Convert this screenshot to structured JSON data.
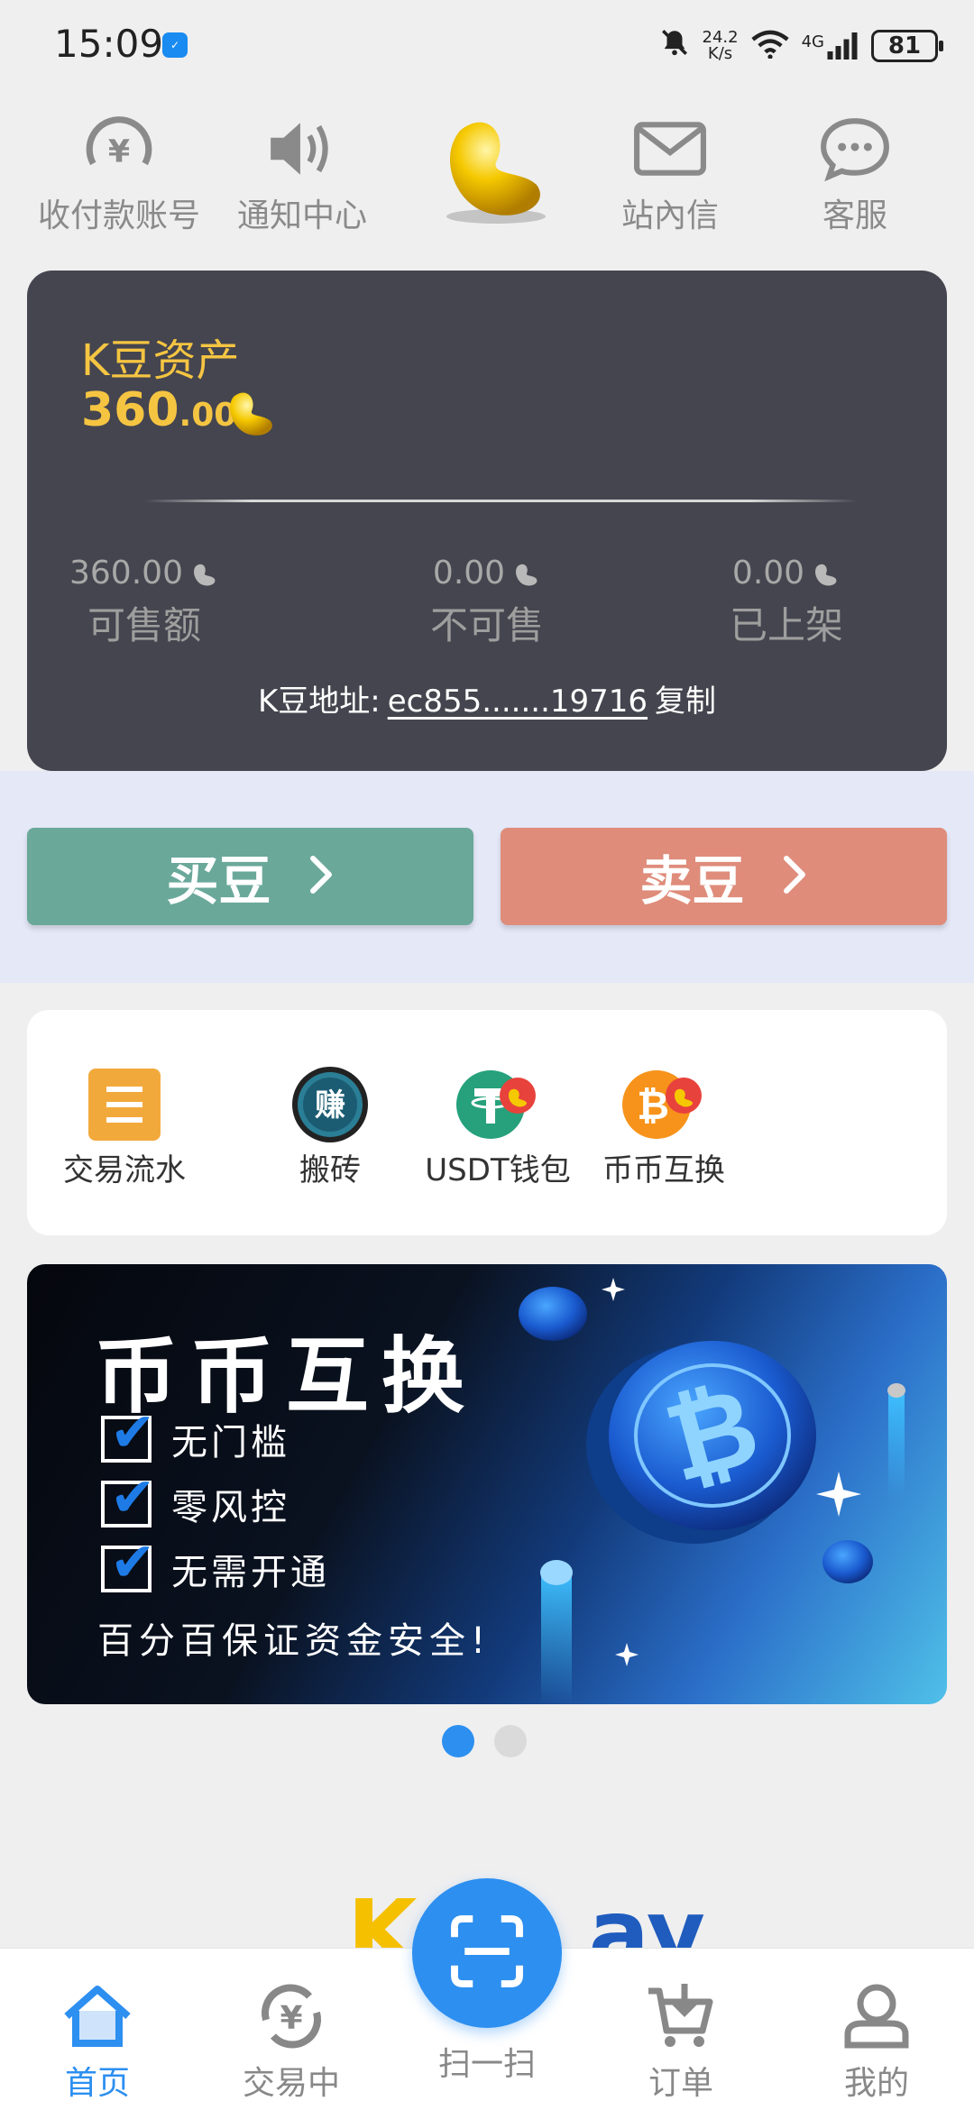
{
  "status_bar": {
    "time": "15:09",
    "net_speed_value": "24.2",
    "net_speed_unit": "K/s",
    "network": "4G",
    "battery": "81"
  },
  "top_nav": [
    {
      "label": "收付款账号",
      "icon": "yen-icon"
    },
    {
      "label": "通知中心",
      "icon": "speaker-icon"
    },
    {
      "label": "站內信",
      "icon": "mail-icon"
    },
    {
      "label": "客服",
      "icon": "chat-icon"
    }
  ],
  "asset": {
    "title": "K豆资产",
    "amount_int": "360",
    "amount_dec": ".00",
    "stats": [
      {
        "int": "360",
        "dec": ".00",
        "label": "可售额"
      },
      {
        "int": "0",
        "dec": ".00",
        "label": "不可售"
      },
      {
        "int": "0",
        "dec": ".00",
        "label": "已上架"
      }
    ],
    "address_label": "K豆地址:",
    "address_value": "ec855.......19716",
    "copy_label": "复制"
  },
  "trade": {
    "buy_label": "买豆",
    "sell_label": "卖豆"
  },
  "quick_menu": [
    {
      "label": "交易流水",
      "icon": "ledger-icon"
    },
    {
      "label": "搬砖",
      "icon": "earn-icon",
      "icon_text": "赚"
    },
    {
      "label": "USDT钱包",
      "icon": "usdt-icon"
    },
    {
      "label": "币币互换",
      "icon": "btc-exchange-icon"
    }
  ],
  "banner": {
    "title": "币币互换",
    "checks": [
      "无门槛",
      "零风控",
      "无需开通"
    ],
    "footer": "百分百保证资金安全!",
    "page_count": 2,
    "active_page": 1
  },
  "bottom_nav": {
    "items": [
      {
        "label": "首页",
        "icon": "home-icon",
        "active": true
      },
      {
        "label": "交易中",
        "icon": "trading-icon",
        "active": false
      },
      {
        "label": "订单",
        "icon": "cart-icon",
        "active": false
      },
      {
        "label": "我的",
        "icon": "profile-icon",
        "active": false
      }
    ],
    "scan_label": "扫一扫"
  },
  "colors": {
    "accent": "#2d8ff0",
    "gold": "#f5c542",
    "buy": "#6aa89a",
    "sell": "#df8c7b",
    "card_dark": "#45454f"
  }
}
